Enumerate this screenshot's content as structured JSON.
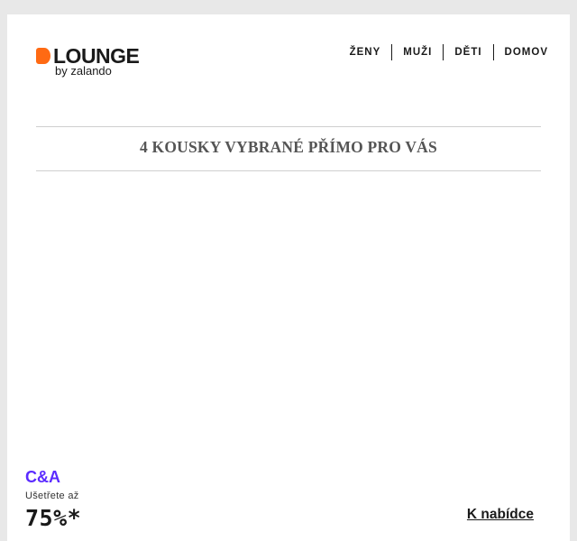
{
  "header": {
    "logo": {
      "wordmark": "LOUNGE",
      "tagline": "by zalando",
      "accent_color": "#ff6a13"
    },
    "nav": [
      {
        "label": "ŽENY"
      },
      {
        "label": "MUŽI"
      },
      {
        "label": "DĚTI"
      },
      {
        "label": "DOMOV"
      }
    ]
  },
  "main": {
    "headline": "4 KOUSKY VYBRANÉ PŘÍMO PRO VÁS",
    "offer": {
      "brand": "C&A",
      "brand_color": "#5b2bff",
      "save_label": "Ušetřete až",
      "discount": "75%*",
      "cta_label": "K nabídce"
    }
  }
}
